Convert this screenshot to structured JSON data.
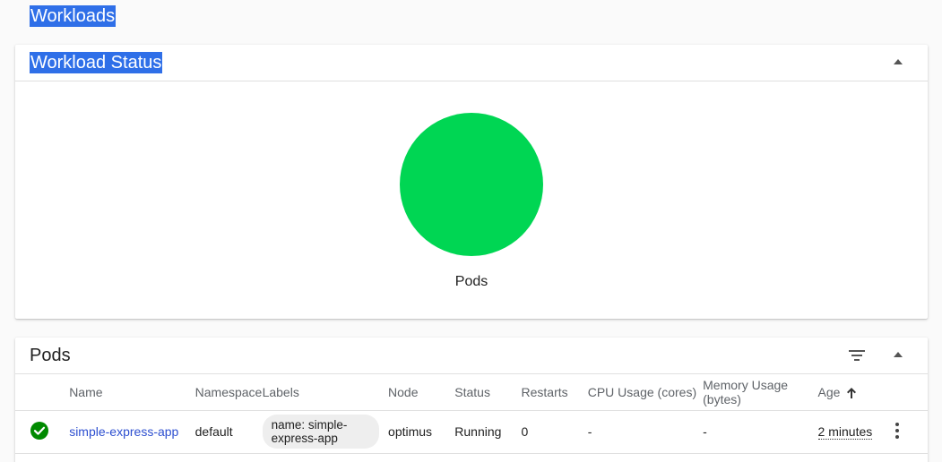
{
  "page": {
    "title": "Workloads"
  },
  "workload_status": {
    "title": "Workload Status",
    "chart_label": "Pods",
    "color": "#00d653"
  },
  "pods": {
    "title": "Pods",
    "columns": {
      "name": "Name",
      "namespace": "Namespace",
      "labels": "Labels",
      "node": "Node",
      "status": "Status",
      "restarts": "Restarts",
      "cpu": "CPU Usage (cores)",
      "memory": "Memory Usage (bytes)",
      "age": "Age"
    },
    "rows": [
      {
        "status_icon": "check-circle-icon",
        "name": "simple-express-app",
        "namespace": "default",
        "labels": "name: simple-express-app",
        "node": "optimus",
        "status": "Running",
        "restarts": "0",
        "cpu": "-",
        "memory": "-",
        "age": "2 minutes"
      }
    ]
  },
  "colors": {
    "accent": "#2d4fd0",
    "success": "#00d653",
    "ok_icon": "#008a00",
    "highlight": "#2f6fe8"
  }
}
